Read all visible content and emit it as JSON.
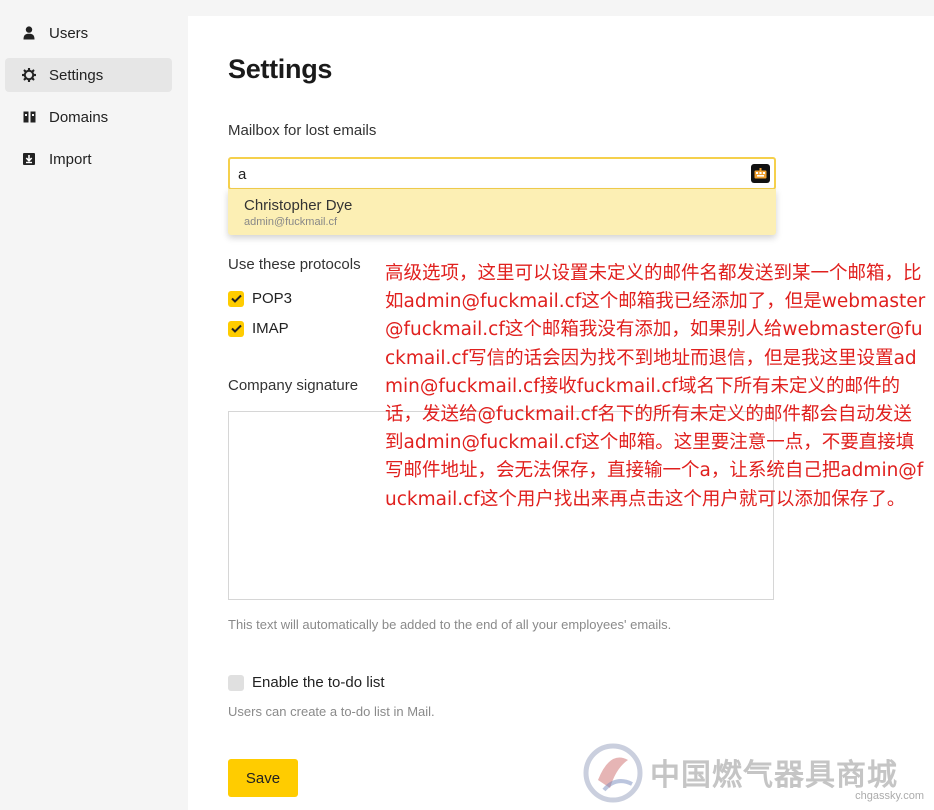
{
  "sidebar": {
    "items": [
      {
        "label": "Users",
        "icon": "user-icon"
      },
      {
        "label": "Settings",
        "icon": "gear-icon",
        "active": true
      },
      {
        "label": "Domains",
        "icon": "domains-icon"
      },
      {
        "label": "Import",
        "icon": "import-icon"
      }
    ]
  },
  "main": {
    "title": "Settings",
    "lost_mailbox": {
      "label": "Mailbox for lost emails",
      "value": "a",
      "suggestion": {
        "name": "Christopher Dye",
        "email": "admin@fuckmail.cf"
      }
    },
    "protocols": {
      "label": "Use these protocols",
      "items": [
        {
          "label": "POP3",
          "checked": true
        },
        {
          "label": "IMAP",
          "checked": true
        }
      ]
    },
    "signature": {
      "label": "Company signature",
      "value": "",
      "hint": "This text will automatically be added to the end of all your employees' emails."
    },
    "todo": {
      "label": "Enable the to-do list",
      "checked": false,
      "hint": "Users can create a to-do list in Mail."
    },
    "save_label": "Save"
  },
  "annotation": {
    "text": "高级选项，这里可以设置未定义的邮件名都发送到某一个邮箱，比如admin@fuckmail.cf这个邮箱我已经添加了，但是webmaster@fuckmail.cf这个邮箱我没有添加，如果别人给webmaster@fuckmail.cf写信的话会因为找不到地址而退信，但是我这里设置admin@fuckmail.cf接收fuckmail.cf域名下所有未定义的邮件的话，发送给@fuckmail.cf名下的所有未定义的邮件都会自动发送到admin@fuckmail.cf这个邮箱。这里要注意一点，不要直接填写邮件地址，会无法保存，直接输一个a，让系统自己把admin@fuckmail.cf这个用户找出来再点击这个用户就可以添加保存了。",
    "color": "#e0201e"
  },
  "watermark": {
    "text": "中国燃气器具商城",
    "url": "chgassky.com"
  },
  "colors": {
    "accent": "#ffcc00",
    "input_border": "#f5d04c",
    "dropdown_bg": "#fcefb4"
  }
}
